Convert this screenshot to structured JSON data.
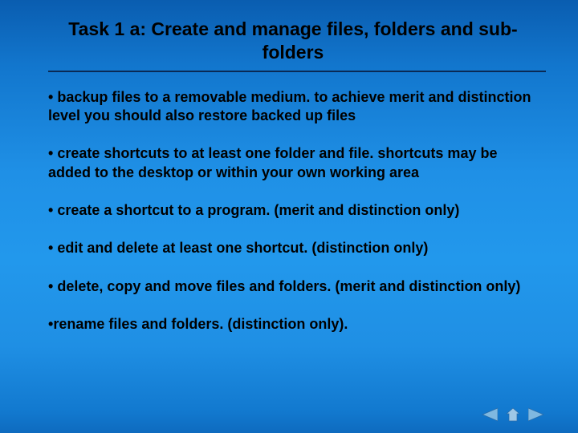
{
  "title": "Task 1 a: Create and manage files, folders and sub-folders",
  "bullets": [
    "backup files to a removable medium. to achieve merit and distinction level you should also restore backed up files",
    "create shortcuts to at least one folder and file. shortcuts may be added to the desktop or within your own working area",
    "create a shortcut to a program. (merit and distinction only)",
    "edit and delete at least one shortcut. (distinction only)",
    "delete, copy and move files and folders. (merit and distinction only)",
    "rename files and folders. (distinction only)."
  ],
  "bullet_marker": "•",
  "bullet_marker_tight": "•"
}
